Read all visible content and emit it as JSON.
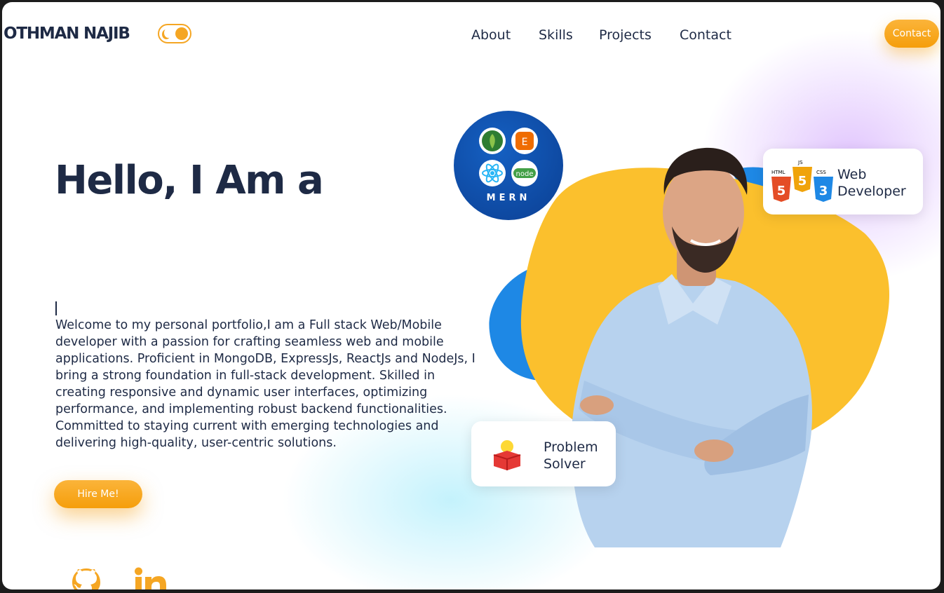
{
  "header": {
    "logo": "OTHMAN NAJIB",
    "theme_toggle_icon": "moon-icon",
    "nav": [
      "About",
      "Skills",
      "Projects",
      "Contact"
    ],
    "contact_button": "Contact"
  },
  "hero": {
    "headline": "Hello, I Am a",
    "intro": "Welcome to my personal portfolio,I am a Full stack Web/Mobile developer with a passion for crafting seamless web and mobile applications. Proficient in MongoDB, ExpressJs, ReactJs and NodeJs, I bring a strong foundation in full-stack development. Skilled in creating responsive and dynamic user interfaces, optimizing performance, and implementing robust backend functionalities. Committed to staying current with emerging technologies and delivering high-quality, user-centric solutions.",
    "hire_button": "Hire Me!"
  },
  "badges": {
    "mern": {
      "label": "MERN",
      "icons": [
        "mongodb-icon",
        "express-icon",
        "react-icon",
        "node-icon"
      ]
    },
    "web_developer": {
      "line1": "Web",
      "line2": "Developer",
      "icons": [
        "html5-icon",
        "js-icon",
        "css3-icon"
      ],
      "icon_labels": [
        "HTML",
        "JS",
        "CSS"
      ]
    },
    "problem_solver": {
      "line1": "Problem",
      "line2": "Solver",
      "icon": "lightbulb-box-icon"
    }
  },
  "social": [
    "github-icon",
    "linkedin-icon"
  ],
  "colors": {
    "accent": "#f5a623",
    "blob_yellow": "#fbc02d",
    "blob_blue": "#1e88e5",
    "text": "#1e2a45"
  }
}
